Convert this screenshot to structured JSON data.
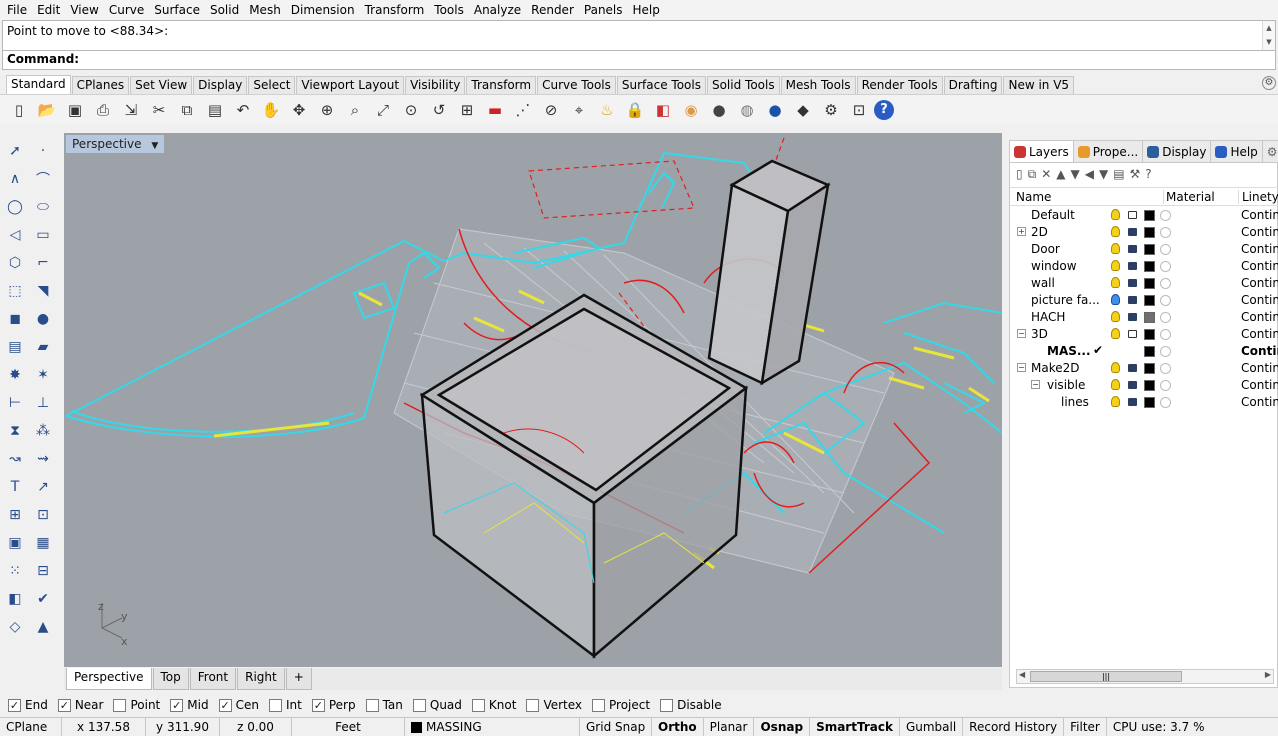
{
  "menu": [
    "File",
    "Edit",
    "View",
    "Curve",
    "Surface",
    "Solid",
    "Mesh",
    "Dimension",
    "Transform",
    "Tools",
    "Analyze",
    "Render",
    "Panels",
    "Help"
  ],
  "command": {
    "history_text": "Point to move to <88.34>:",
    "prompt_label": "Command:"
  },
  "tabs": [
    "Standard",
    "CPlanes",
    "Set View",
    "Display",
    "Select",
    "Viewport Layout",
    "Visibility",
    "Transform",
    "Curve Tools",
    "Surface Tools",
    "Solid Tools",
    "Mesh Tools",
    "Render Tools",
    "Drafting",
    "New in V5"
  ],
  "active_tab": "Standard",
  "toolbar_icons": [
    "new-file-icon",
    "open-file-icon",
    "save-icon",
    "print-icon",
    "import-icon",
    "cut-icon",
    "copy-icon",
    "paste-icon",
    "undo-icon",
    "pan-icon",
    "rotate-view-icon",
    "zoom-dynamic-icon",
    "zoom-window-icon",
    "zoom-extents-icon",
    "zoom-selected-icon",
    "undo-view-icon",
    "four-viewports-icon",
    "car-icon",
    "grid-icon",
    "cplane-icon",
    "snap-icon",
    "light-icon",
    "lock-icon",
    "layers-icon",
    "color-wheel-icon",
    "shade-icon",
    "render-icon",
    "sphere-icon",
    "material-icon",
    "options-icon",
    "dimension-icon",
    "help-icon"
  ],
  "viewport": {
    "label": "Perspective",
    "background": "#9da2a9",
    "tabs": [
      "Perspective",
      "Top",
      "Front",
      "Right"
    ],
    "active_view": "Perspective",
    "axes": {
      "z": "z",
      "y": "y",
      "x": "x"
    }
  },
  "osnaps": [
    {
      "label": "End",
      "checked": true
    },
    {
      "label": "Near",
      "checked": true
    },
    {
      "label": "Point",
      "checked": false
    },
    {
      "label": "Mid",
      "checked": true
    },
    {
      "label": "Cen",
      "checked": true
    },
    {
      "label": "Int",
      "checked": false
    },
    {
      "label": "Perp",
      "checked": true
    },
    {
      "label": "Tan",
      "checked": false
    },
    {
      "label": "Quad",
      "checked": false
    },
    {
      "label": "Knot",
      "checked": false
    },
    {
      "label": "Vertex",
      "checked": false
    },
    {
      "label": "Project",
      "checked": false
    },
    {
      "label": "Disable",
      "checked": false
    }
  ],
  "status": {
    "cplane": "CPlane",
    "x": "x 137.58",
    "y": "y 311.90",
    "z": "z 0.00",
    "units": "Feet",
    "layer": "MASSING",
    "grid_snap": "Grid Snap",
    "ortho": "Ortho",
    "planar": "Planar",
    "osnap": "Osnap",
    "smarttrack": "SmartTrack",
    "gumball": "Gumball",
    "record_history": "Record History",
    "filter": "Filter",
    "cpu": "CPU use: 3.7 %"
  },
  "panel": {
    "tabs": [
      "Layers",
      "Prope...",
      "Display",
      "Help"
    ],
    "active": "Layers",
    "columns": {
      "name": "Name",
      "material": "Material",
      "linetype": "Linetyp"
    },
    "layers": [
      {
        "name": "Default",
        "indent": 0,
        "expander": "",
        "bulb": "on",
        "lock": "open",
        "color": "#000000",
        "linetype": "Continu"
      },
      {
        "name": "2D",
        "indent": 0,
        "expander": "+",
        "bulb": "on",
        "lock": "locked",
        "color": "#000000",
        "linetype": "Continu"
      },
      {
        "name": "Door",
        "indent": 0,
        "expander": "",
        "bulb": "on",
        "lock": "locked",
        "color": "#000000",
        "linetype": "Continu"
      },
      {
        "name": "window",
        "indent": 0,
        "expander": "",
        "bulb": "on",
        "lock": "locked",
        "color": "#000000",
        "linetype": "Continu"
      },
      {
        "name": "wall",
        "indent": 0,
        "expander": "",
        "bulb": "on",
        "lock": "locked",
        "color": "#000000",
        "linetype": "Continu"
      },
      {
        "name": "picture fa...",
        "indent": 0,
        "expander": "",
        "bulb": "blue",
        "lock": "locked",
        "color": "#000000",
        "linetype": "Continu"
      },
      {
        "name": "HACH",
        "indent": 0,
        "expander": "",
        "bulb": "on",
        "lock": "locked",
        "color": "#707070",
        "linetype": "Continu"
      },
      {
        "name": "3D",
        "indent": 0,
        "expander": "−",
        "bulb": "on",
        "lock": "open",
        "color": "#000000",
        "linetype": "Continu"
      },
      {
        "name": "MAS...",
        "indent": 1,
        "expander": "",
        "bulb": "",
        "lock": "",
        "color": "#000000",
        "linetype": "Contin",
        "current": true,
        "check": "✔"
      },
      {
        "name": "Make2D",
        "indent": 0,
        "expander": "−",
        "bulb": "on",
        "lock": "locked",
        "color": "#000000",
        "linetype": "Continu"
      },
      {
        "name": "visible",
        "indent": 1,
        "expander": "−",
        "bulb": "on",
        "lock": "locked",
        "color": "#000000",
        "linetype": "Continu"
      },
      {
        "name": "lines",
        "indent": 2,
        "expander": "",
        "bulb": "on",
        "lock": "locked",
        "color": "#000000",
        "linetype": "Continu"
      }
    ]
  }
}
